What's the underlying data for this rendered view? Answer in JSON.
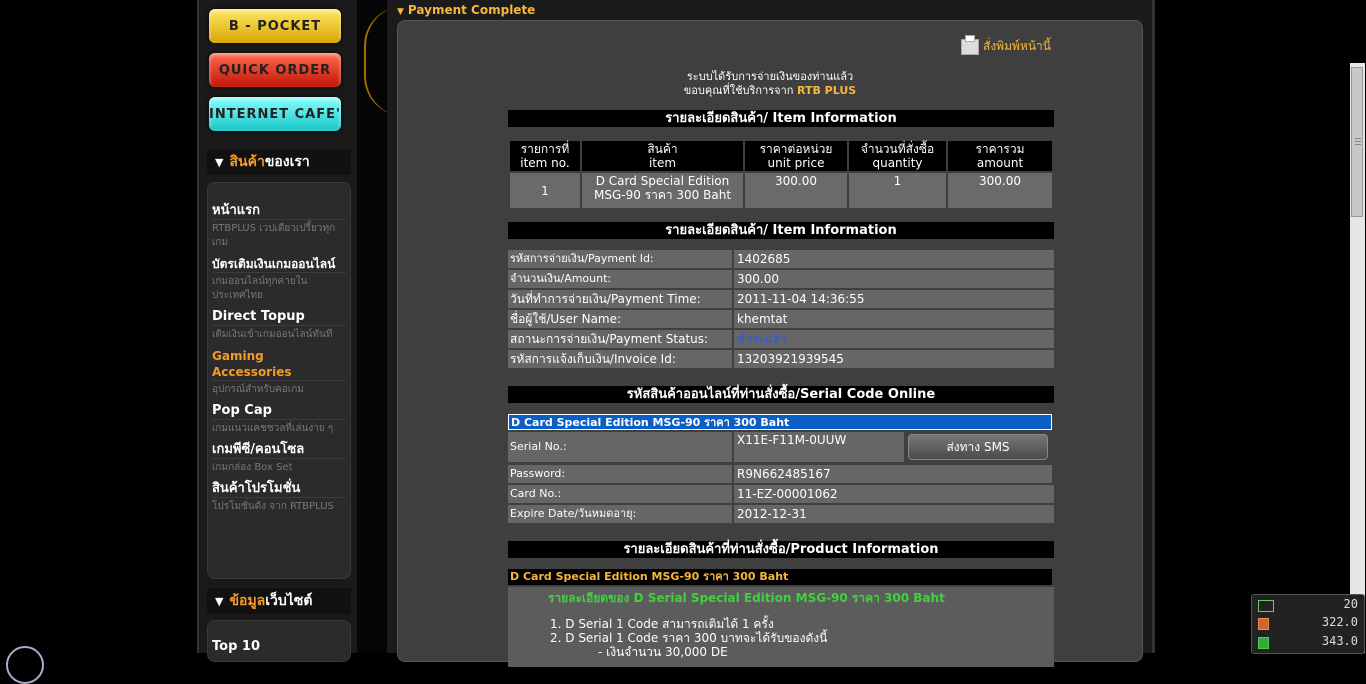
{
  "promo": {
    "bpocket": "B - POCKET",
    "quick": "QUICK ORDER",
    "cafe": "INTERNET CAFE'"
  },
  "sidebar": {
    "products_head_hl": "สินค้า",
    "products_head_rest": "ของเรา",
    "items": [
      {
        "title": "หน้าแรก",
        "sub": "RTBPLUS เวปเดียวเปรี้ยวทุกเกม"
      },
      {
        "title": "บัตรเติมเงินเกมออนไลน์",
        "sub": "เกมออนไลน์ทุกค่ายในประเทศไทย"
      },
      {
        "title": "Direct Topup",
        "sub": "เติมเงินเข้าเกมออนไลน์ทันที"
      },
      {
        "title": "Gaming Accessories",
        "sub": "อุปกรณ์สำหรับคอเกม"
      },
      {
        "title": "Pop Cap",
        "sub": "เกมแนวแคชชวลที่เล่นง่าย ๆ"
      },
      {
        "title": "เกมพีซี/คอนโซล",
        "sub": "เกมกล่อง Box Set"
      },
      {
        "title": "สินค้าโปรโมชั่น",
        "sub": "โปรโมชั่นดัง จาก RTBPLUS"
      }
    ],
    "site_head_hl": "ข้อมูล",
    "site_head_rest": "เว็บไซต์",
    "site_items": [
      "Top 10"
    ]
  },
  "main": {
    "header": "Payment Complete",
    "print_label": "สั่งพิมพ์หน้านี้",
    "thanks_line1": "ระบบได้รับการจ่ายเงินของท่านแล้ว",
    "thanks_line2_prefix": "ขอบคุณที่ใช้บริการจาก ",
    "thanks_brand": "RTB PLUS"
  },
  "item_info": {
    "title": "รายละเอียดสินค้า/ Item Information",
    "headers": [
      [
        "รายการที่",
        "item no."
      ],
      [
        "สินค้า",
        "item"
      ],
      [
        "ราคาต่อหน่วย",
        "unit price"
      ],
      [
        "จำนวนที่สั่งซื้อ",
        "quantity"
      ],
      [
        "ราคารวม",
        "amount"
      ]
    ],
    "rows": [
      {
        "no": "1",
        "item_line1": "D Card Special Edition",
        "item_line2": "MSG-90 ราคา 300 Baht",
        "unit_price": "300.00",
        "quantity": "1",
        "amount": "300.00"
      }
    ]
  },
  "payment_info": {
    "title": "รายละเอียดสินค้า/ Item Information",
    "rows": [
      {
        "label": "รหัสการจ่ายเงิน/Payment Id:",
        "value": "1402685"
      },
      {
        "label": "จำนวนเงิน/Amount:",
        "value": "300.00"
      },
      {
        "label": "วันที่ทำการจ่ายเงิน/Payment Time:",
        "value": "2011-11-04 14:36:55"
      },
      {
        "label": "ชื่อผู้ใช้/User Name:",
        "value": "khemtat"
      },
      {
        "label": "สถานะการจ่ายเงิน/Payment Status:",
        "value": "ชำระแล้ว"
      },
      {
        "label": "รหัสการแจ้งเก็บเงิน/Invoice Id:",
        "value": "13203921939545"
      }
    ],
    "status_color": "#2d5bd6"
  },
  "serial_info": {
    "title": "รหัสสินค้าออนไลน์ที่ท่านสั่งซื้อ/Serial Code Online",
    "product": "D Card Special Edition MSG-90 ราคา 300 Baht",
    "rows": [
      {
        "label": "Serial No.:",
        "value": "X11E-F11M-0UUW"
      },
      {
        "label": "Password:",
        "value": "R9N662485167"
      },
      {
        "label": "Card No.:",
        "value": "11-EZ-00001062"
      },
      {
        "label": "Expire Date/วันหมดอายุ:",
        "value": "2012-12-31"
      }
    ],
    "sms_button": "ส่งทาง SMS"
  },
  "product_info": {
    "title": "รายละเอียดสินค้าที่ท่านสั่งซื้อ/Product Information",
    "product": "D Card Special Edition MSG-90 ราคา 300 Baht",
    "detail_head": "รายละเอียดของ D Serial Special Edition MSG-90 ราคา 300 Baht",
    "lines": [
      "1.  D Serial 1 Code สามารถเติมได้ 1 ครั้ง",
      "2.  D Serial 1 Code ราคา 300 บาทจะได้รับของดังนี้",
      "- เงินจำนวน 30,000 DE"
    ]
  },
  "widget": {
    "top": "20",
    "mid": "322.0",
    "bottom": "343.0"
  }
}
